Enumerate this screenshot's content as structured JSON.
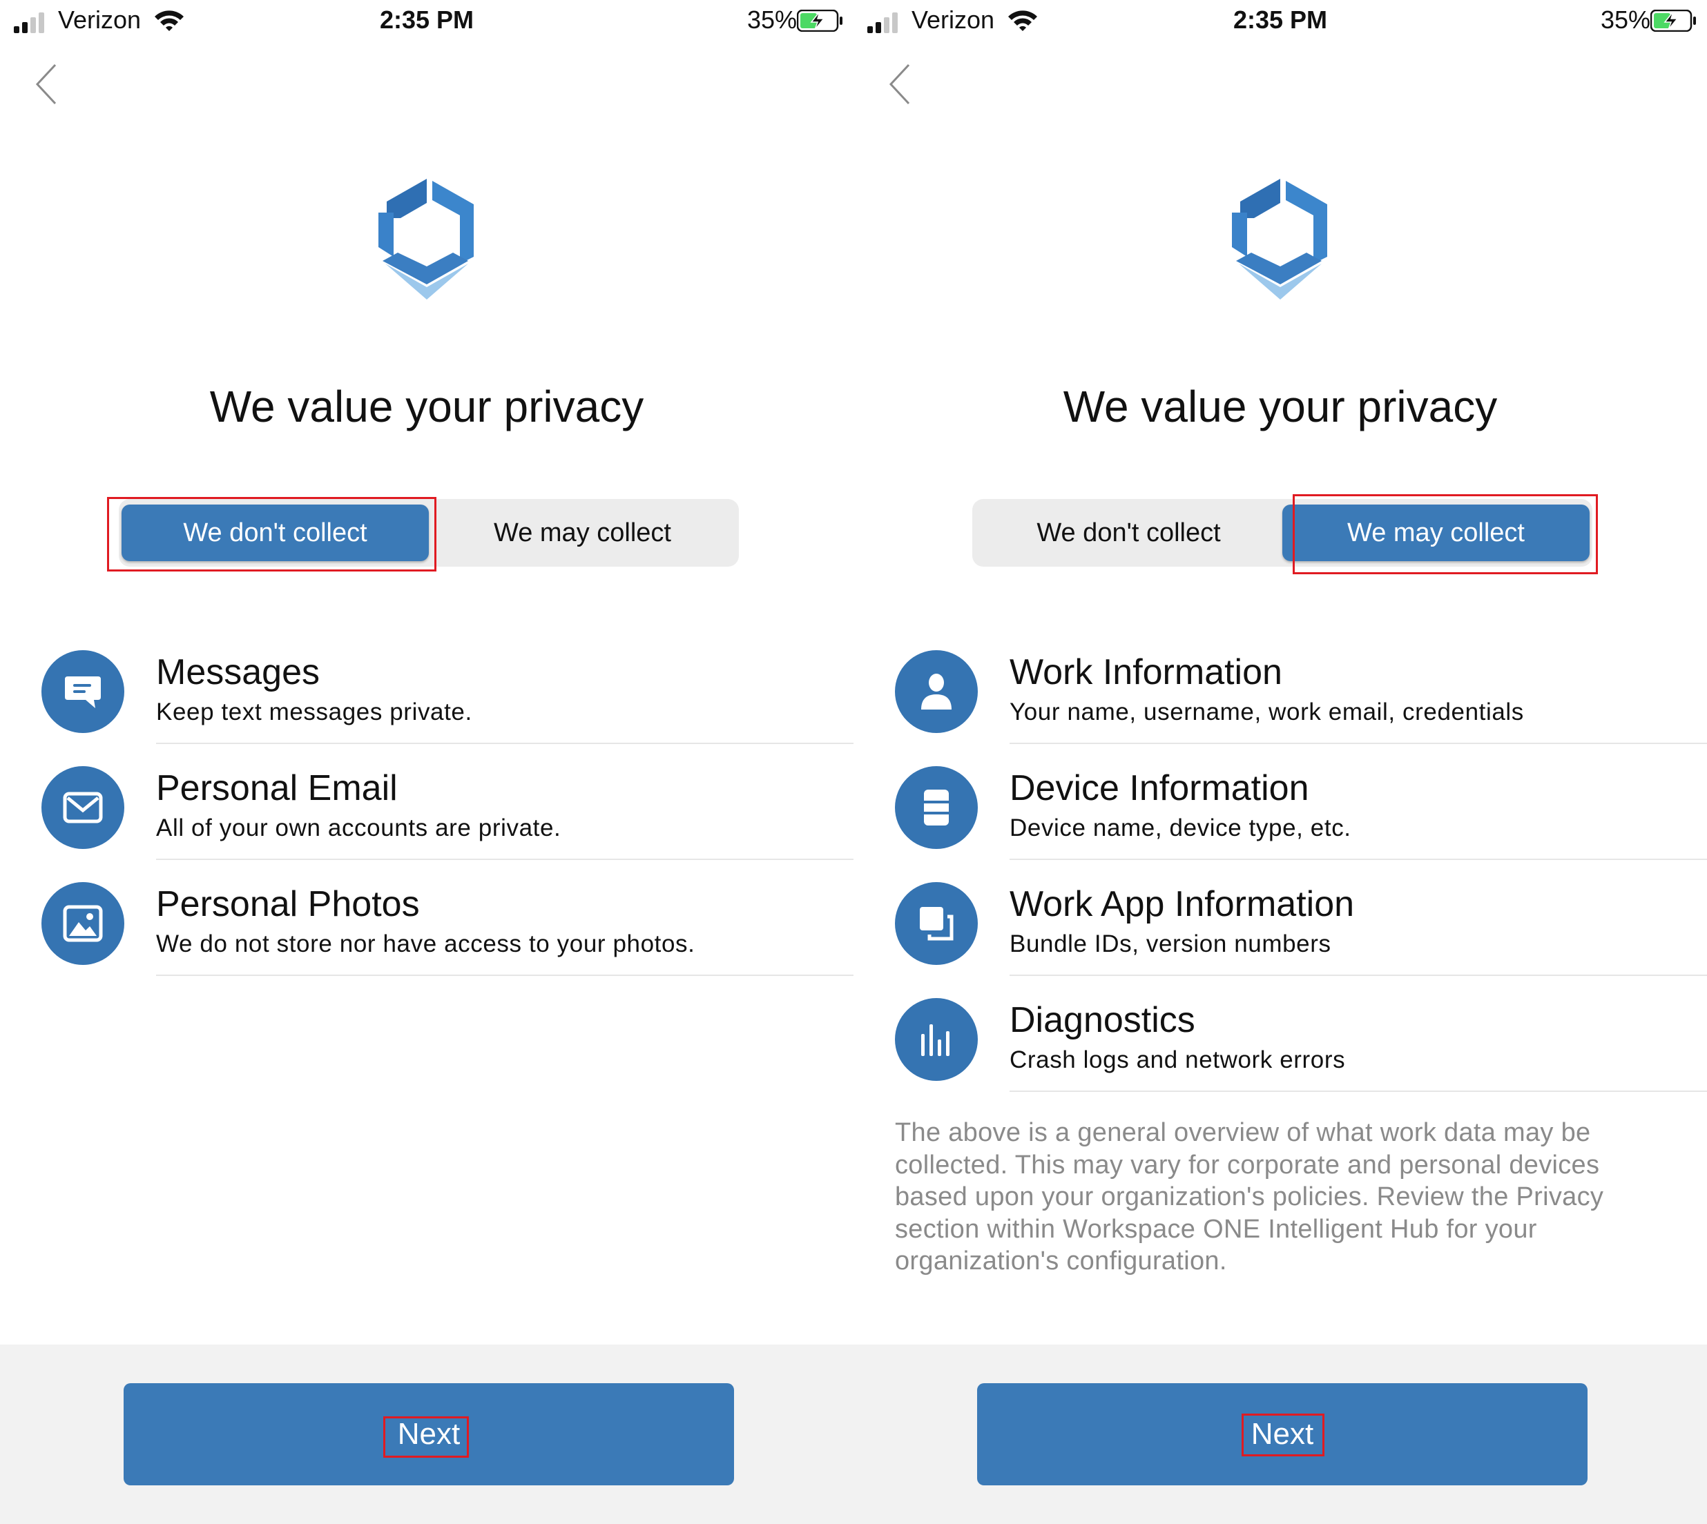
{
  "status_bar": {
    "carrier": "Verizon",
    "time": "2:35 PM",
    "battery": "35%"
  },
  "brand_color": "#3b7ab7",
  "highlight_color": "#e01b22",
  "screens": [
    {
      "title": "We value your privacy",
      "segment": {
        "left": "We don't collect",
        "right": "We may collect",
        "selected": "left"
      },
      "items": [
        {
          "icon": "message-icon",
          "title": "Messages",
          "subtitle": "Keep text messages private."
        },
        {
          "icon": "envelope-icon",
          "title": "Personal Email",
          "subtitle": "All of your own accounts are private."
        },
        {
          "icon": "photo-icon",
          "title": "Personal Photos",
          "subtitle": "We do not store nor have access to your photos."
        }
      ],
      "next_label": "Next"
    },
    {
      "title": "We value your privacy",
      "segment": {
        "left": "We don't collect",
        "right": "We may collect",
        "selected": "right"
      },
      "items": [
        {
          "icon": "person-icon",
          "title": "Work Information",
          "subtitle": "Your name, username, work email, credentials"
        },
        {
          "icon": "device-icon",
          "title": "Device Information",
          "subtitle": "Device name, device type, etc."
        },
        {
          "icon": "app-icon",
          "title": "Work App Information",
          "subtitle": "Bundle IDs, version numbers"
        },
        {
          "icon": "diagnostics-icon",
          "title": "Diagnostics",
          "subtitle": "Crash logs and network errors"
        }
      ],
      "note": "The above is a general overview of what work data may be collected.  This may vary for corporate and personal devices based upon your organization's policies.  Review the Privacy section within Workspace ONE Intelligent Hub for your organization's configuration.",
      "next_label": "Next"
    }
  ]
}
